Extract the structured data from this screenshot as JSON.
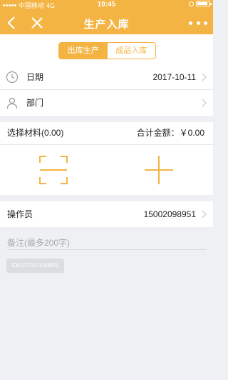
{
  "status_bar": {
    "carrier": "中国移动",
    "network": "4G",
    "time": "19:45",
    "battery_level": 0.9
  },
  "nav": {
    "title": "生产入库"
  },
  "tabs": [
    {
      "label": "出库生产",
      "active": true
    },
    {
      "label": "成品入库",
      "active": false
    }
  ],
  "date_row": {
    "label": "日期",
    "value": "2017-10-11"
  },
  "department_row": {
    "label": "部门",
    "value": ""
  },
  "materials": {
    "label": "选择材料(0.00)",
    "total": "合计金额：￥0.00"
  },
  "actions": {
    "scan": "scan-icon",
    "add": "plus-icon"
  },
  "operator": {
    "label": "操作员",
    "value": "15002098951"
  },
  "remark": {
    "placeholder": "备注(最多200字)"
  },
  "code": "CKD17101100001",
  "colors": {
    "accent": "#f4b443",
    "background": "#eef0f4"
  }
}
